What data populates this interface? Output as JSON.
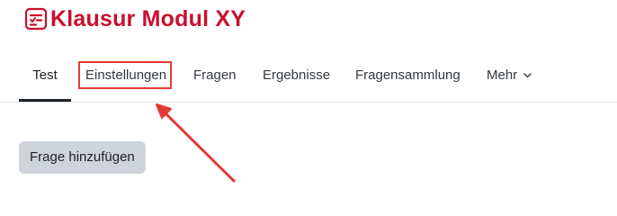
{
  "header": {
    "title": "Klausur Modul XY",
    "icon": "quiz-icon",
    "title_color": "#c8102e"
  },
  "nav": {
    "tabs": [
      {
        "label": "Test",
        "active": true
      },
      {
        "label": "Einstellungen",
        "active": false,
        "highlighted": true
      },
      {
        "label": "Fragen",
        "active": false
      },
      {
        "label": "Ergebnisse",
        "active": false
      },
      {
        "label": "Fragensammlung",
        "active": false
      },
      {
        "label": "Mehr",
        "active": false,
        "icon": "chevron-down-icon"
      }
    ]
  },
  "main": {
    "add_question_label": "Frage hinzufügen"
  },
  "annotation": {
    "color": "#e53935",
    "target": "Einstellungen"
  }
}
